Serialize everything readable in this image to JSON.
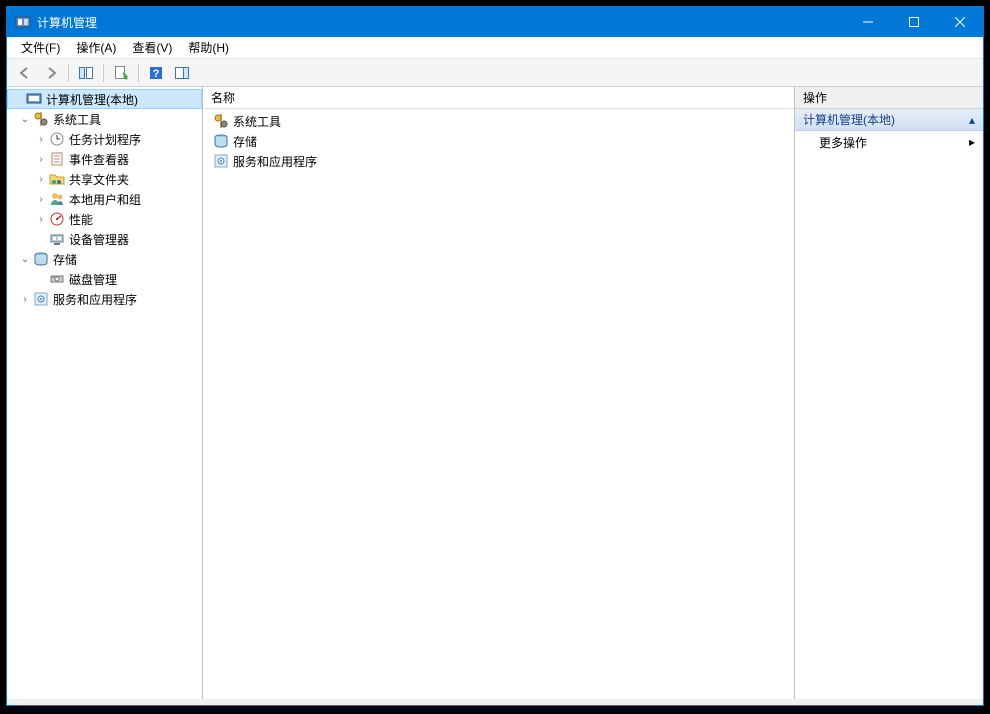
{
  "title": "计算机管理",
  "menu": [
    "文件(F)",
    "操作(A)",
    "查看(V)",
    "帮助(H)"
  ],
  "tree": {
    "root": "计算机管理(本地)",
    "nodes": {
      "system_tools": "系统工具",
      "task_scheduler": "任务计划程序",
      "event_viewer": "事件查看器",
      "shared_folders": "共享文件夹",
      "local_users": "本地用户和组",
      "performance": "性能",
      "device_manager": "设备管理器",
      "storage": "存储",
      "disk_mgmt": "磁盘管理",
      "services_apps": "服务和应用程序"
    }
  },
  "list": {
    "header": "名称",
    "items": [
      "系统工具",
      "存储",
      "服务和应用程序"
    ]
  },
  "actions": {
    "pane_title": "操作",
    "group": "计算机管理(本地)",
    "more": "更多操作"
  }
}
